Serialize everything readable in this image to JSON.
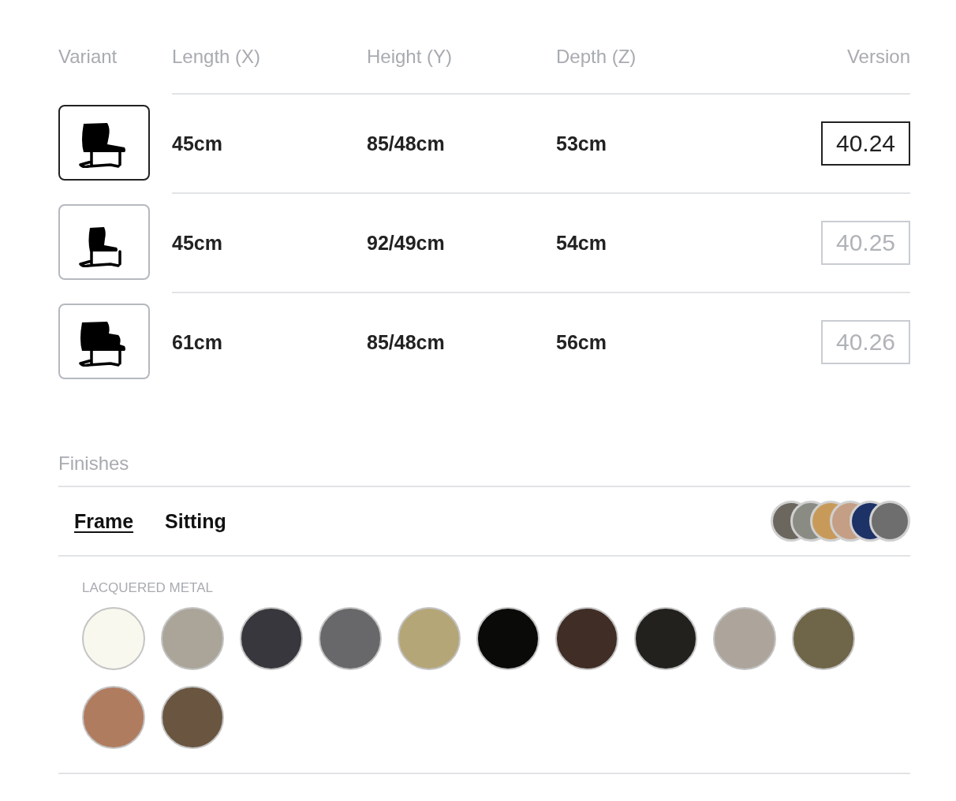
{
  "table": {
    "columns": [
      "Variant",
      "Length (X)",
      "Height (Y)",
      "Depth (Z)",
      "Version"
    ],
    "rows": [
      {
        "variant": {
          "kind": "chair"
        },
        "length": "45cm",
        "height": "85/48cm",
        "depth": "53cm",
        "version": "40.24",
        "selected": true
      },
      {
        "variant": {
          "kind": "small-chair"
        },
        "length": "45cm",
        "height": "92/49cm",
        "depth": "54cm",
        "version": "40.25",
        "selected": false
      },
      {
        "variant": {
          "kind": "armchair"
        },
        "length": "61cm",
        "height": "85/48cm",
        "depth": "56cm",
        "version": "40.26",
        "selected": false
      }
    ]
  },
  "finishes": {
    "title": "Finishes",
    "tabs": [
      {
        "label": "Frame",
        "selected": true
      },
      {
        "label": "Sitting",
        "selected": false
      }
    ],
    "preview_swatches": [
      {
        "color": "#6b675f"
      },
      {
        "color": "#8a8c84"
      },
      {
        "color": "#c89a5a"
      },
      {
        "color": "#c49f85"
      },
      {
        "color": "#1d3266"
      },
      {
        "color": "#6e6e6e"
      }
    ],
    "group": "LACQUERED METAL",
    "swatches": [
      {
        "color": "#f9f8ee"
      },
      {
        "color": "#aaa598"
      },
      {
        "color": "#38373d"
      },
      {
        "color": "#68676a"
      },
      {
        "color": "#b5a678"
      },
      {
        "color": "#0a0a08"
      },
      {
        "color": "#402d26"
      },
      {
        "color": "#22211e"
      },
      {
        "color": "#ada59b"
      },
      {
        "color": "#6f6548"
      },
      {
        "color": "#b07c60"
      },
      {
        "color": "#6a5540"
      }
    ]
  }
}
